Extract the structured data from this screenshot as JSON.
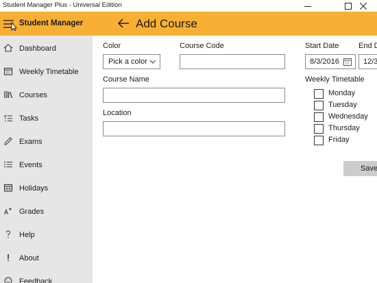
{
  "window": {
    "title": "Student Manager Plus - Universal Edition",
    "minimize_icon": "minimize-icon",
    "maximize_icon": "maximize-icon",
    "close_icon": "close-icon"
  },
  "header": {
    "app_name": "Student Manager",
    "page_title": "Add Course",
    "background": "#f7b033"
  },
  "sidebar": {
    "items": [
      {
        "label": "Dashboard",
        "icon": "home-icon"
      },
      {
        "label": "Weekly Timetable",
        "icon": "calendar-icon"
      },
      {
        "label": "Courses",
        "icon": "books-icon"
      },
      {
        "label": "Tasks",
        "icon": "checklist-icon"
      },
      {
        "label": "Exams",
        "icon": "pencil-icon"
      },
      {
        "label": "Events",
        "icon": "bullet-list-icon"
      },
      {
        "label": "Holidays",
        "icon": "calendar-grid-icon"
      },
      {
        "label": "Grades",
        "icon": "grades-icon"
      },
      {
        "label": "Help",
        "icon": "question-icon"
      },
      {
        "label": "About",
        "icon": "exclamation-icon"
      },
      {
        "label": "Feedback",
        "icon": "smiley-icon"
      }
    ]
  },
  "form": {
    "color_label": "Color",
    "color_value": "Pick a color",
    "course_code_label": "Course Code",
    "course_code_value": "",
    "course_name_label": "Course Name",
    "course_name_value": "",
    "location_label": "Location",
    "location_value": "",
    "start_date_label": "Start Date",
    "start_date_value": "8/3/2016",
    "end_date_label": "End D",
    "end_date_value": "12/3",
    "weekly_timetable_label": "Weekly Timetable",
    "days": [
      {
        "label": "Monday",
        "checked": false
      },
      {
        "label": "Tuesday",
        "checked": false
      },
      {
        "label": "Wednesday",
        "checked": false
      },
      {
        "label": "Thursday",
        "checked": false
      },
      {
        "label": "Friday",
        "checked": false
      }
    ],
    "save_label": "Save"
  }
}
